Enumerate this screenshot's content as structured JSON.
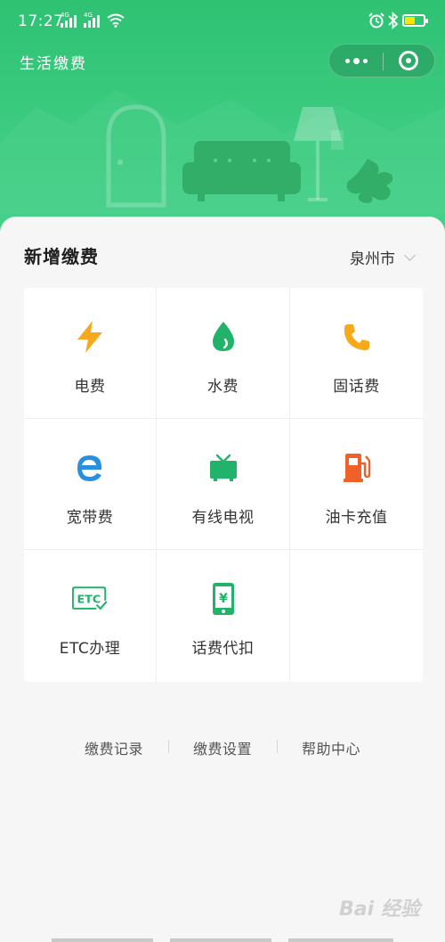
{
  "status_bar": {
    "time": "17:27",
    "network_1": "4G",
    "network_2": "4G"
  },
  "header": {
    "title": "生活缴费",
    "background_color": "#36c57a"
  },
  "main": {
    "section_title": "新增缴费",
    "city": "泉州市",
    "services": [
      {
        "label": "电费",
        "icon": "lightning-icon",
        "color": "#f7a81b"
      },
      {
        "label": "水费",
        "icon": "water-drop-icon",
        "color": "#22b36a"
      },
      {
        "label": "固话费",
        "icon": "phone-icon",
        "color": "#f7a81b"
      },
      {
        "label": "宽带费",
        "icon": "ie-browser-icon",
        "color": "#2b8fe0"
      },
      {
        "label": "有线电视",
        "icon": "tv-icon",
        "color": "#22b36a"
      },
      {
        "label": "油卡充值",
        "icon": "gas-station-icon",
        "color": "#f0612a"
      },
      {
        "label": "ETC办理",
        "icon": "etc-card-icon",
        "color": "#22b36a"
      },
      {
        "label": "话费代扣",
        "icon": "mobile-yuan-icon",
        "color": "#22b36a"
      }
    ]
  },
  "footer": {
    "links": [
      "缴费记录",
      "缴费设置",
      "帮助中心"
    ]
  },
  "watermark": "Bai 经验"
}
